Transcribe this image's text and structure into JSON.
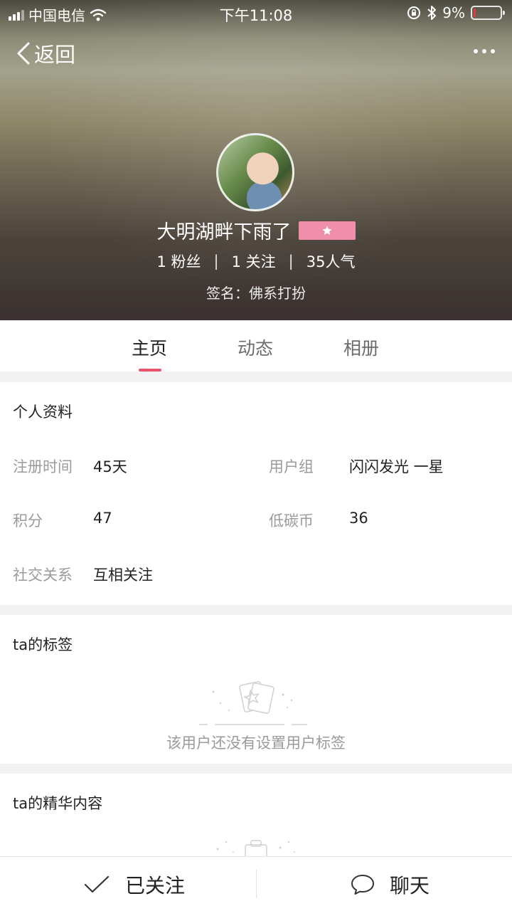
{
  "status_bar": {
    "carrier": "中国电信",
    "time": "下午11:08",
    "battery_percent": "9%",
    "battery_level": 0.09,
    "icons": [
      "signal-icon",
      "wifi-icon",
      "orientation-lock-icon",
      "bluetooth-icon",
      "battery-icon"
    ]
  },
  "nav": {
    "back_label": "返回",
    "more_icon": "more-dots-icon"
  },
  "profile": {
    "username": "大明湖畔下雨了",
    "level_badge_icon": "star-icon",
    "badge_color": "#ef8fab",
    "fans": "1 粉丝",
    "following": "1 关注",
    "popularity": "35人气",
    "separator": "|",
    "signature": "签名：佛系打扮"
  },
  "tabs": [
    {
      "label": "主页",
      "active": true
    },
    {
      "label": "动态",
      "active": false
    },
    {
      "label": "相册",
      "active": false
    }
  ],
  "accent_color": "#e8556a",
  "personal_info": {
    "title": "个人资料",
    "fields": {
      "register_time": {
        "label": "注册时间",
        "value": "45天"
      },
      "user_group": {
        "label": "用户组",
        "value": "闪闪发光 一星"
      },
      "points": {
        "label": "积分",
        "value": "47"
      },
      "carbon_coins": {
        "label": "低碳币",
        "value": "36"
      },
      "social": {
        "label": "社交关系",
        "value": "互相关注"
      }
    }
  },
  "tags": {
    "title": "ta的标签",
    "empty_text": "该用户还没有设置用户标签"
  },
  "featured": {
    "title": "ta的精华内容"
  },
  "bottom_bar": {
    "follow_label": "已关注",
    "chat_label": "聊天"
  }
}
